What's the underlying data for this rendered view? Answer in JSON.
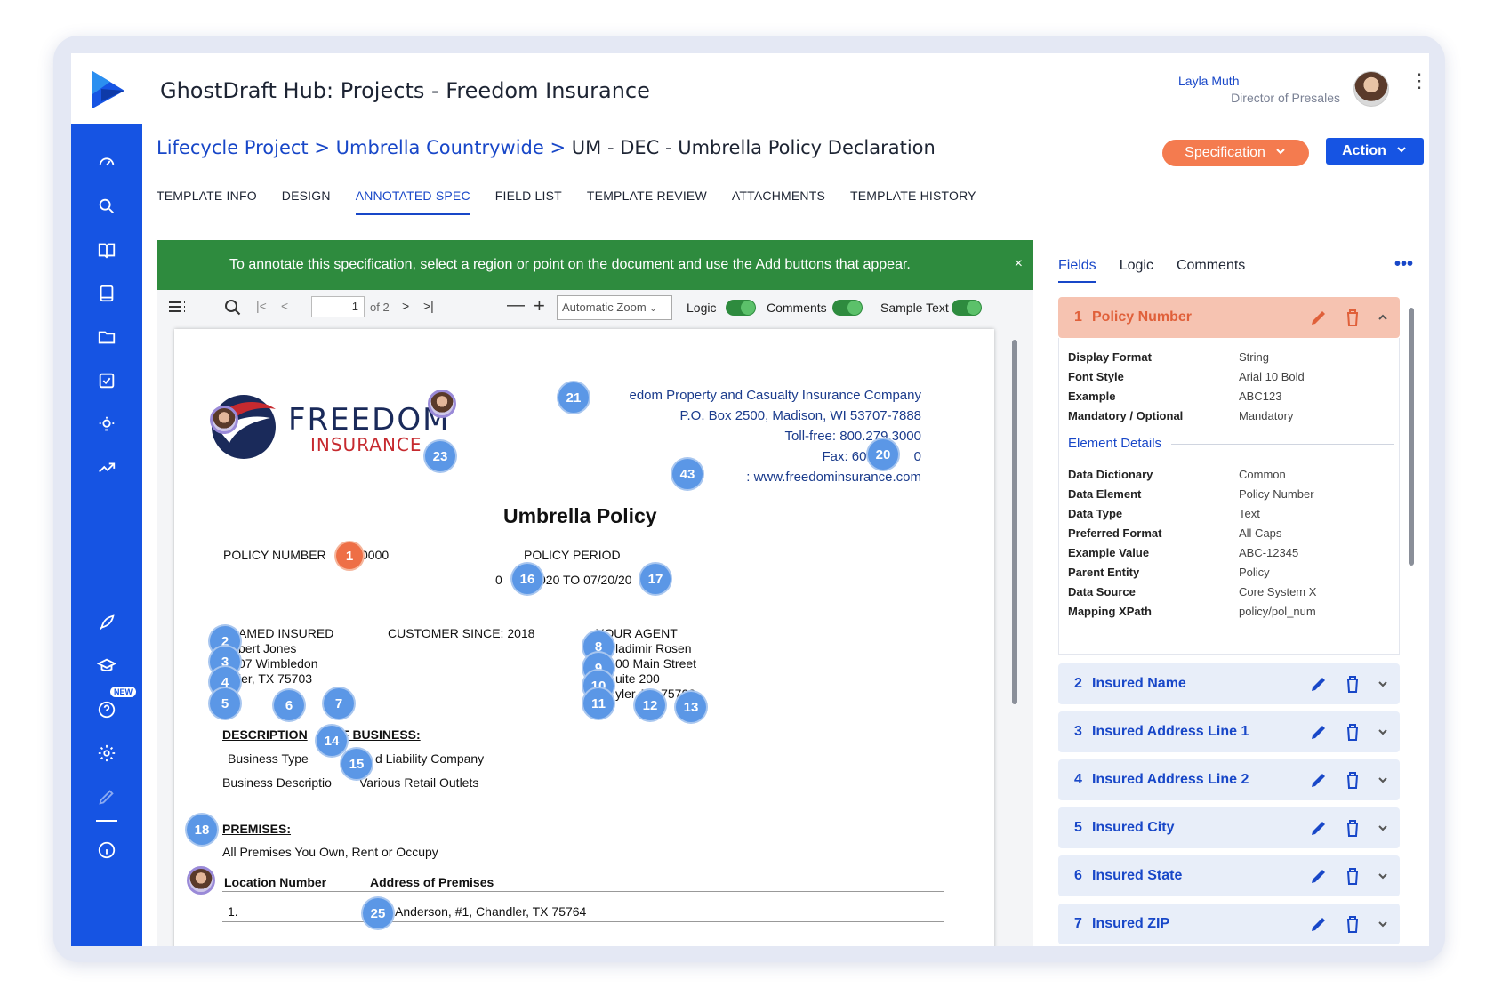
{
  "app": {
    "title": "GhostDraft Hub: Projects - Freedom Insurance"
  },
  "user": {
    "name": "Layla Muth",
    "role": "Director of Presales"
  },
  "breadcrumb": {
    "level1": "Lifecycle Project",
    "sep1": ">",
    "level2": "Umbrella Countrywide",
    "sep2": ">",
    "current": "UM - DEC - Umbrella Policy Declaration"
  },
  "buttons": {
    "specification": "Specification",
    "action": "Action"
  },
  "tabs": [
    "TEMPLATE INFO",
    "DESIGN",
    "ANNOTATED SPEC",
    "FIELD LIST",
    "TEMPLATE REVIEW",
    "ATTACHMENTS",
    "TEMPLATE HISTORY"
  ],
  "nav": {
    "new_badge": "NEW"
  },
  "banner": {
    "text": "To annotate this specification, select a region or point on the document and use the Add buttons that appear.",
    "close": "×"
  },
  "viewer": {
    "page_value": "1",
    "page_of": "of 2",
    "zoom": "Automatic Zoom",
    "toggles": [
      "Logic",
      "Comments",
      "Sample Text"
    ]
  },
  "document": {
    "logo_word": "FREEDOM",
    "logo_sub": "INSURANCE",
    "company_name": "Freedom Property and Casualty Insurance Company",
    "company_name_visible": "edom Property and Casualty Insurance Company",
    "address": "P.O. Box 2500, Madison, WI 53707-7888",
    "tollfree": "Toll-free: 800.279.3000",
    "fax": "Fax: 608.223",
    "fax_end": "0",
    "web": ": www.freedominsurance.com",
    "title": "Umbrella Policy",
    "policy_number_label": "POLICY NUMBER",
    "policy_number_tail": "0000",
    "policy_period_label": "POLICY PERIOD",
    "period_start": "0",
    "period_mid": "020 TO 07/20/20",
    "named_insured": "AMED INSURED",
    "customer_since": "CUSTOMER SINCE: 2018",
    "your_agent": "YOUR AGENT",
    "insured_name": "bert Jones",
    "insured_addr": "07 Wimbledon",
    "insured_city": "ler, TX  75703",
    "agent_name": "ladimir Rosen",
    "agent_addr": "00 Main Street",
    "agent_suite": "uite 200",
    "agent_city": "yler, TX  75703",
    "desc_label_a": "DESCRIPTION",
    "desc_label_b": "F BUSINESS:",
    "business_type": "Business Type",
    "business_type_val": "d Liability Company",
    "business_desc": "Business Descriptio",
    "business_desc_val": "Various Retail Outlets",
    "premises": "PREMISES:",
    "premises_text": "All Premises You Own, Rent or Occupy",
    "loc_number": "Location Number",
    "addr_premises": "Address of Premises",
    "row_num": "1.",
    "row_addr": "Anderson, #1, Chandler, TX  75764"
  },
  "markers": [
    "21",
    "23",
    "20",
    "43",
    "1",
    "16",
    "17",
    "2",
    "3",
    "4",
    "5",
    "6",
    "7",
    "8",
    "9",
    "10",
    "11",
    "12",
    "13",
    "14",
    "15",
    "18",
    "25"
  ],
  "right_panel": {
    "tabs": [
      "Fields",
      "Logic",
      "Comments"
    ],
    "more": "•••",
    "open_field": {
      "num": "1",
      "name": "Policy Number"
    },
    "basic": [
      {
        "k": "Display Format",
        "v": "String"
      },
      {
        "k": "Font Style",
        "v": "Arial 10 Bold"
      },
      {
        "k": "Example",
        "v": "ABC123"
      },
      {
        "k": "Mandatory / Optional",
        "v": "Mandatory"
      }
    ],
    "element_details_title": "Element Details",
    "element": [
      {
        "k": "Data Dictionary",
        "v": "Common"
      },
      {
        "k": "Data Element",
        "v": "Policy Number"
      },
      {
        "k": "Data Type",
        "v": "Text"
      },
      {
        "k": "Preferred Format",
        "v": "All Caps"
      },
      {
        "k": "Example Value",
        "v": "ABC-12345"
      },
      {
        "k": "Parent Entity",
        "v": "Policy"
      },
      {
        "k": "Data Source",
        "v": "Core System X"
      },
      {
        "k": "Mapping XPath",
        "v": "policy/pol_num"
      }
    ],
    "fields": [
      {
        "num": "2",
        "name": "Insured Name"
      },
      {
        "num": "3",
        "name": "Insured Address Line 1"
      },
      {
        "num": "4",
        "name": "Insured Address Line 2"
      },
      {
        "num": "5",
        "name": "Insured City"
      },
      {
        "num": "6",
        "name": "Insured State"
      },
      {
        "num": "7",
        "name": "Insured ZIP"
      }
    ]
  },
  "colors": {
    "brand_blue": "#1654e3",
    "accent_orange": "#f47b4f",
    "banner_green": "#2e8b3e",
    "marker_blue": "#5b97e6"
  }
}
